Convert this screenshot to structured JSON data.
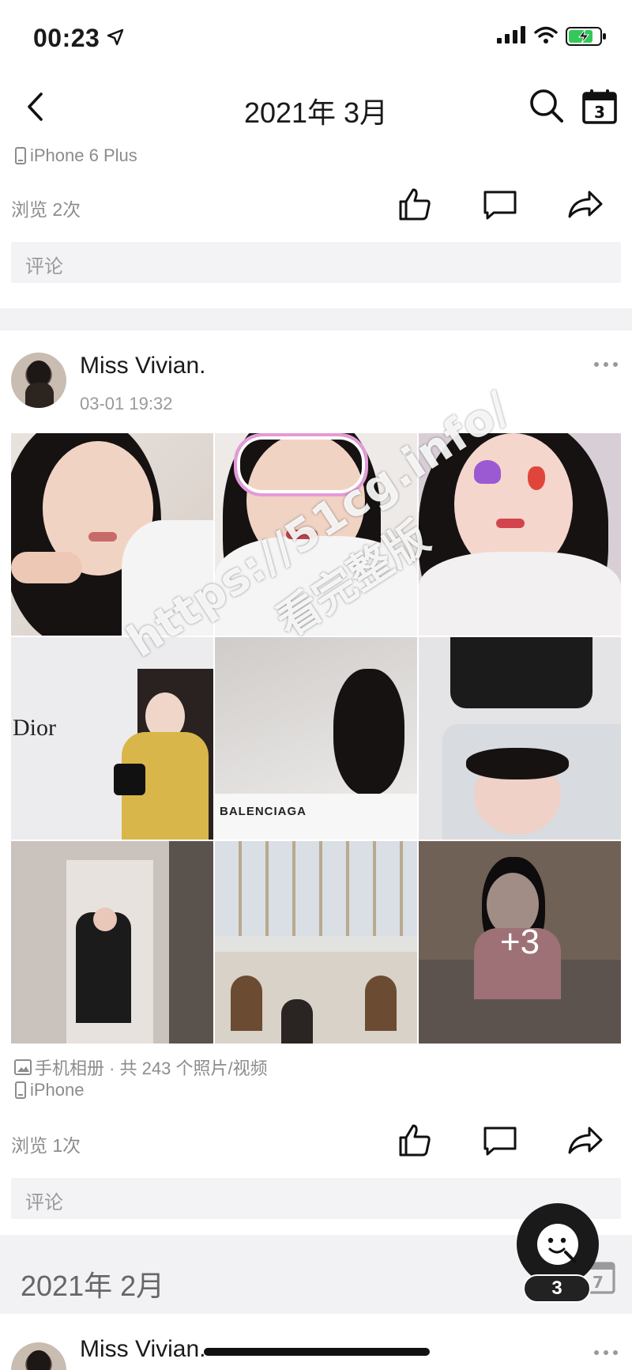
{
  "status_bar": {
    "time": "00:23"
  },
  "nav": {
    "title": "2021年 3月",
    "calendar_day": "3"
  },
  "prev_post": {
    "device": "iPhone 6 Plus",
    "views": "浏览 2次",
    "comment_placeholder": "评论"
  },
  "post": {
    "author": "Miss Vivian.",
    "time": "03-01 19:32",
    "more_count": "+3",
    "album_info": "手机相册 · 共 243 个照片/视频",
    "device": "iPhone",
    "views": "浏览 1次",
    "comment_placeholder": "评论",
    "photo_texts": {
      "dior": "Dior",
      "balenciaga": "BALENCIAGA"
    }
  },
  "watermark": {
    "url": "https://51cg.info/",
    "text": "看完整版"
  },
  "month_section": {
    "label": "2021年 2月",
    "calendar_day": "7"
  },
  "next_post": {
    "author": "Miss Vivian."
  },
  "assistant": {
    "badge": "3"
  }
}
